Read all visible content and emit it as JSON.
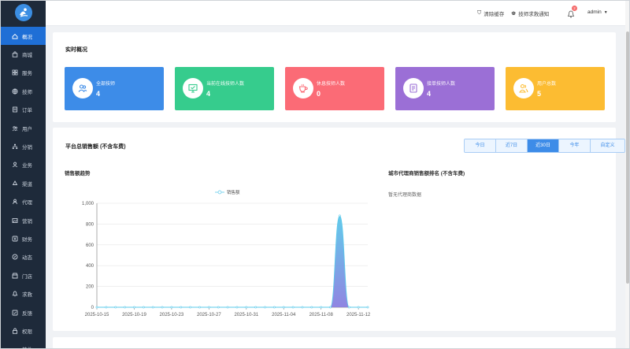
{
  "sidebar": {
    "items": [
      {
        "label": "概况",
        "icon": "home-icon",
        "active": true
      },
      {
        "label": "商城",
        "icon": "bag-icon"
      },
      {
        "label": "服务",
        "icon": "grid-icon"
      },
      {
        "label": "技师",
        "icon": "globe-icon"
      },
      {
        "label": "订单",
        "icon": "order-icon"
      },
      {
        "label": "用户",
        "icon": "users-icon"
      },
      {
        "label": "分销",
        "icon": "sitemap-icon"
      },
      {
        "label": "业务",
        "icon": "person-icon"
      },
      {
        "label": "渠道",
        "icon": "recycle-icon"
      },
      {
        "label": "代理",
        "icon": "agent-icon"
      },
      {
        "label": "营销",
        "icon": "image-icon"
      },
      {
        "label": "财务",
        "icon": "finance-icon"
      },
      {
        "label": "动态",
        "icon": "compass-icon"
      },
      {
        "label": "门店",
        "icon": "store-icon"
      },
      {
        "label": "求救",
        "icon": "bell-icon"
      },
      {
        "label": "反馈",
        "icon": "feedback-icon"
      },
      {
        "label": "权限",
        "icon": "lock-icon"
      },
      {
        "label": "其他",
        "icon": "more-icon"
      }
    ]
  },
  "header": {
    "clear_cache": "清除缓存",
    "sos_notice": "技师求救通知",
    "notification_count": "2",
    "user": "admin"
  },
  "overview": {
    "title": "实时概况",
    "cards": [
      {
        "label": "全部技师",
        "value": "4",
        "color": "#3d8ce8",
        "icon": "users-icon"
      },
      {
        "label": "当前在线技师人数",
        "value": "4",
        "color": "#36cc8d",
        "icon": "monitor-icon"
      },
      {
        "label": "休息技师人数",
        "value": "0",
        "color": "#fb6b76",
        "icon": "coffee-icon"
      },
      {
        "label": "接单技师人数",
        "value": "4",
        "color": "#9b6fd6",
        "icon": "document-icon"
      },
      {
        "label": "用户总数",
        "value": "5",
        "color": "#fcbc32",
        "icon": "user-group-icon"
      }
    ]
  },
  "sales": {
    "title": "平台总销售额 (不含车费)",
    "tabs": [
      {
        "label": "今日",
        "active": false
      },
      {
        "label": "近7日",
        "active": false
      },
      {
        "label": "近30日",
        "active": true
      },
      {
        "label": "今年",
        "active": false
      },
      {
        "label": "自定义",
        "active": false
      }
    ],
    "trend_title": "销售额趋势",
    "ranking_title": "城市代理商销售额排名 (不含车费)",
    "ranking_empty": "暂无代理商数据"
  },
  "chart_data": {
    "type": "area",
    "legend": "销售额",
    "x_ticks": [
      "2025-10-15",
      "2025-10-19",
      "2025-10-23",
      "2025-10-27",
      "2025-10-31",
      "2025-11-04",
      "2025-11-08",
      "2025-11-12"
    ],
    "y_ticks": [
      "0",
      "200",
      "400",
      "600",
      "800",
      "1,000"
    ],
    "ylim": [
      0,
      1000
    ],
    "x": [
      "2025-10-15",
      "2025-10-16",
      "2025-10-17",
      "2025-10-18",
      "2025-10-19",
      "2025-10-20",
      "2025-10-21",
      "2025-10-22",
      "2025-10-23",
      "2025-10-24",
      "2025-10-25",
      "2025-10-26",
      "2025-10-27",
      "2025-10-28",
      "2025-10-29",
      "2025-10-30",
      "2025-10-31",
      "2025-11-01",
      "2025-11-02",
      "2025-11-03",
      "2025-11-04",
      "2025-11-05",
      "2025-11-06",
      "2025-11-07",
      "2025-11-08",
      "2025-11-09",
      "2025-11-10",
      "2025-11-11",
      "2025-11-12",
      "2025-11-13"
    ],
    "values": [
      0,
      0,
      0,
      0,
      0,
      0,
      0,
      0,
      0,
      0,
      0,
      0,
      0,
      0,
      0,
      0,
      0,
      0,
      0,
      0,
      0,
      0,
      0,
      0,
      0,
      0,
      880,
      0,
      0,
      0
    ],
    "series_color": "#5ac8ea",
    "series_color_dark": "#8a7fe0"
  }
}
